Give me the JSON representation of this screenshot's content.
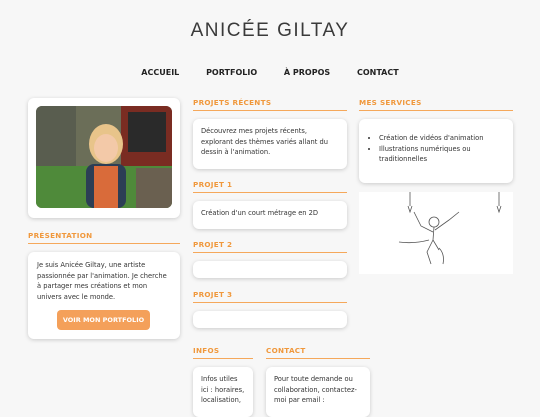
{
  "header": {
    "title": "ANICÉE GILTAY"
  },
  "nav": [
    "ACCUEIL",
    "PORTFOLIO",
    "À PROPOS",
    "CONTACT"
  ],
  "presentation": {
    "heading": "PRÉSENTATION",
    "text": "Je suis Anicée Giltay, une artiste passionnée par l'animation. Je cherche à partager mes créations et mon univers avec le monde.",
    "button": "VOIR MON PORTFOLIO"
  },
  "recent": {
    "heading": "PROJETS RÉCENTS",
    "text": "Découvrez mes projets récents, explorant des thèmes variés allant du dessin à l'animation."
  },
  "projects": [
    {
      "heading": "PROJET 1",
      "text": "Création d'un court métrage en 2D"
    },
    {
      "heading": "PROJET 2",
      "text": ""
    },
    {
      "heading": "PROJET 3",
      "text": ""
    }
  ],
  "services": {
    "heading": "MES SERVICES",
    "items": [
      "Création de vidéos d'animation",
      "Illustrations numériques ou traditionnelles"
    ]
  },
  "infos": {
    "heading": "INFOS",
    "text": "Infos utiles ici : horaires, localisation,"
  },
  "contact": {
    "heading": "CONTACT",
    "text": "Pour toute demande ou collaboration, contactez-moi par email :"
  },
  "colors": {
    "accent": "#f0983c",
    "button": "#f4a05a",
    "background": "#f7f7f7"
  }
}
